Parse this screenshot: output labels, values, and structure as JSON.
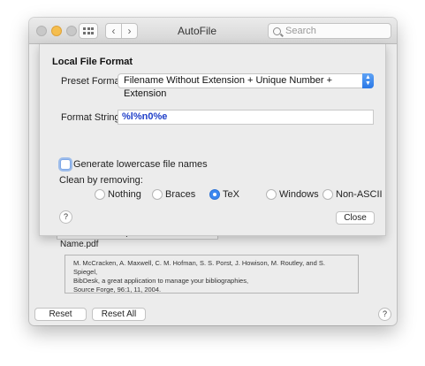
{
  "window": {
    "title": "AutoFile"
  },
  "toolbar": {
    "back_glyph": "‹",
    "forward_glyph": "›"
  },
  "search": {
    "placeholder": "Search"
  },
  "sheet": {
    "title": "Local File Format",
    "preset_label": "Preset Format:",
    "preset_value": "Filename Without Extension + Unique Number + Extension",
    "format_label": "Format String:",
    "format_value": "%l%n0%e",
    "lowercase_label": "Generate lowercase file names",
    "lowercase_checked": false,
    "clean_label": "Clean by removing:",
    "clean_options": [
      "Nothing",
      "Braces",
      "TeX",
      "Windows",
      "Non-ASCII"
    ],
    "clean_selected": "TeX",
    "help_label": "?",
    "close_label": "Close"
  },
  "main": {
    "path_value": "~/Documents/Papers/Local File Name.pdf",
    "preview_lines": [
      "M. McCracken, A. Maxwell, C. M. Hofman, S. S. Porst, J. Howison, M. Routley, and S. Spiegel,",
      "BibDesk, a great application to manage your bibliographies,",
      "Source Forge, 96:1, 11, 2004."
    ],
    "reset_label": "Reset",
    "reset_all_label": "Reset All",
    "help_label": "?"
  },
  "colors": {
    "accent": "#3b87f0",
    "format_text": "#1f3fc9"
  }
}
